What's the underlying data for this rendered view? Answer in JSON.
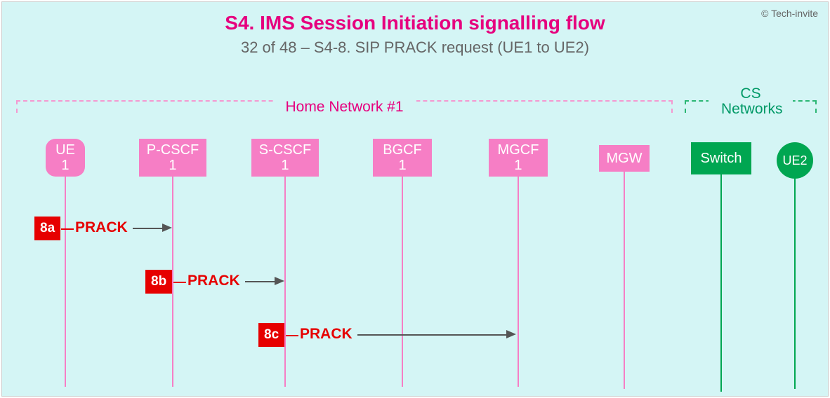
{
  "copyright": "© Tech-invite",
  "title": "S4. IMS Session Initiation signalling flow",
  "subtitle": "32 of 48 – S4-8. SIP PRACK request (UE1 to UE2)",
  "groups": {
    "home": "Home Network #1",
    "cs": "CS Networks"
  },
  "nodes": {
    "ue1": "UE\n1",
    "pcscf1": "P-CSCF\n1",
    "scscf1": "S-CSCF\n1",
    "bgcf1": "BGCF\n1",
    "mgcf1": "MGCF\n1",
    "mgw": "MGW",
    "switch": "Switch",
    "ue2": "UE2"
  },
  "steps": {
    "s1": {
      "id": "8a",
      "msg": "PRACK"
    },
    "s2": {
      "id": "8b",
      "msg": "PRACK"
    },
    "s3": {
      "id": "8c",
      "msg": "PRACK"
    }
  }
}
